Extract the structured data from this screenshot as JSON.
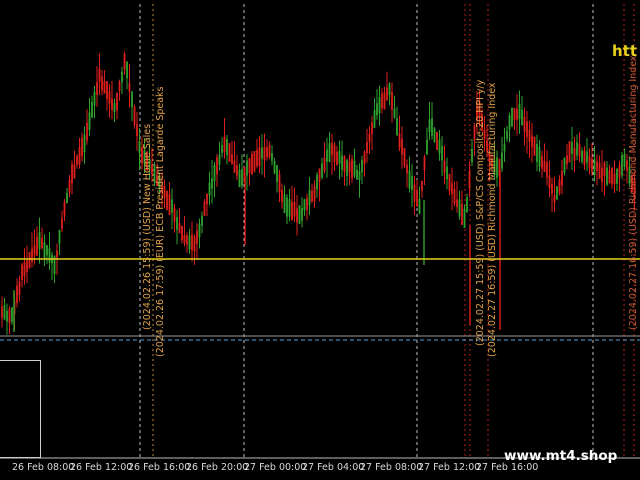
{
  "watermarks": {
    "top": "htt",
    "bottom": "www.mt4.shop"
  },
  "time_axis": [
    "26 Feb 08:00",
    "26 Feb 12:00",
    "26 Feb 16:00",
    "26 Feb 20:00",
    "27 Feb 00:00",
    "27 Feb 04:00",
    "27 Feb 08:00",
    "27 Feb 12:00",
    "27 Feb 16:00"
  ],
  "events": [
    {
      "text": "(2024.02.26 15:59) (USD) New Home Sales"
    },
    {
      "text": "(2024.02.26 17:59) (EUR) ECB President Lagarde Speaks"
    },
    {
      "text": "(2024.02.27 15:59) (USD) S&P/CS Composite-20 HPI y/y"
    },
    {
      "text": "(2024.02.27 16:59) (USD) Richmond Manufacturing Index"
    }
  ],
  "colors": {
    "bull": "#2fa32f",
    "bear": "#e0201c",
    "level": "#e6d21e",
    "grid": "#ffffff",
    "event": "#e0a24a"
  },
  "chart_data": {
    "type": "candlestick",
    "horizontal_level": "yellow line",
    "grid": "dotted vertical lines"
  }
}
